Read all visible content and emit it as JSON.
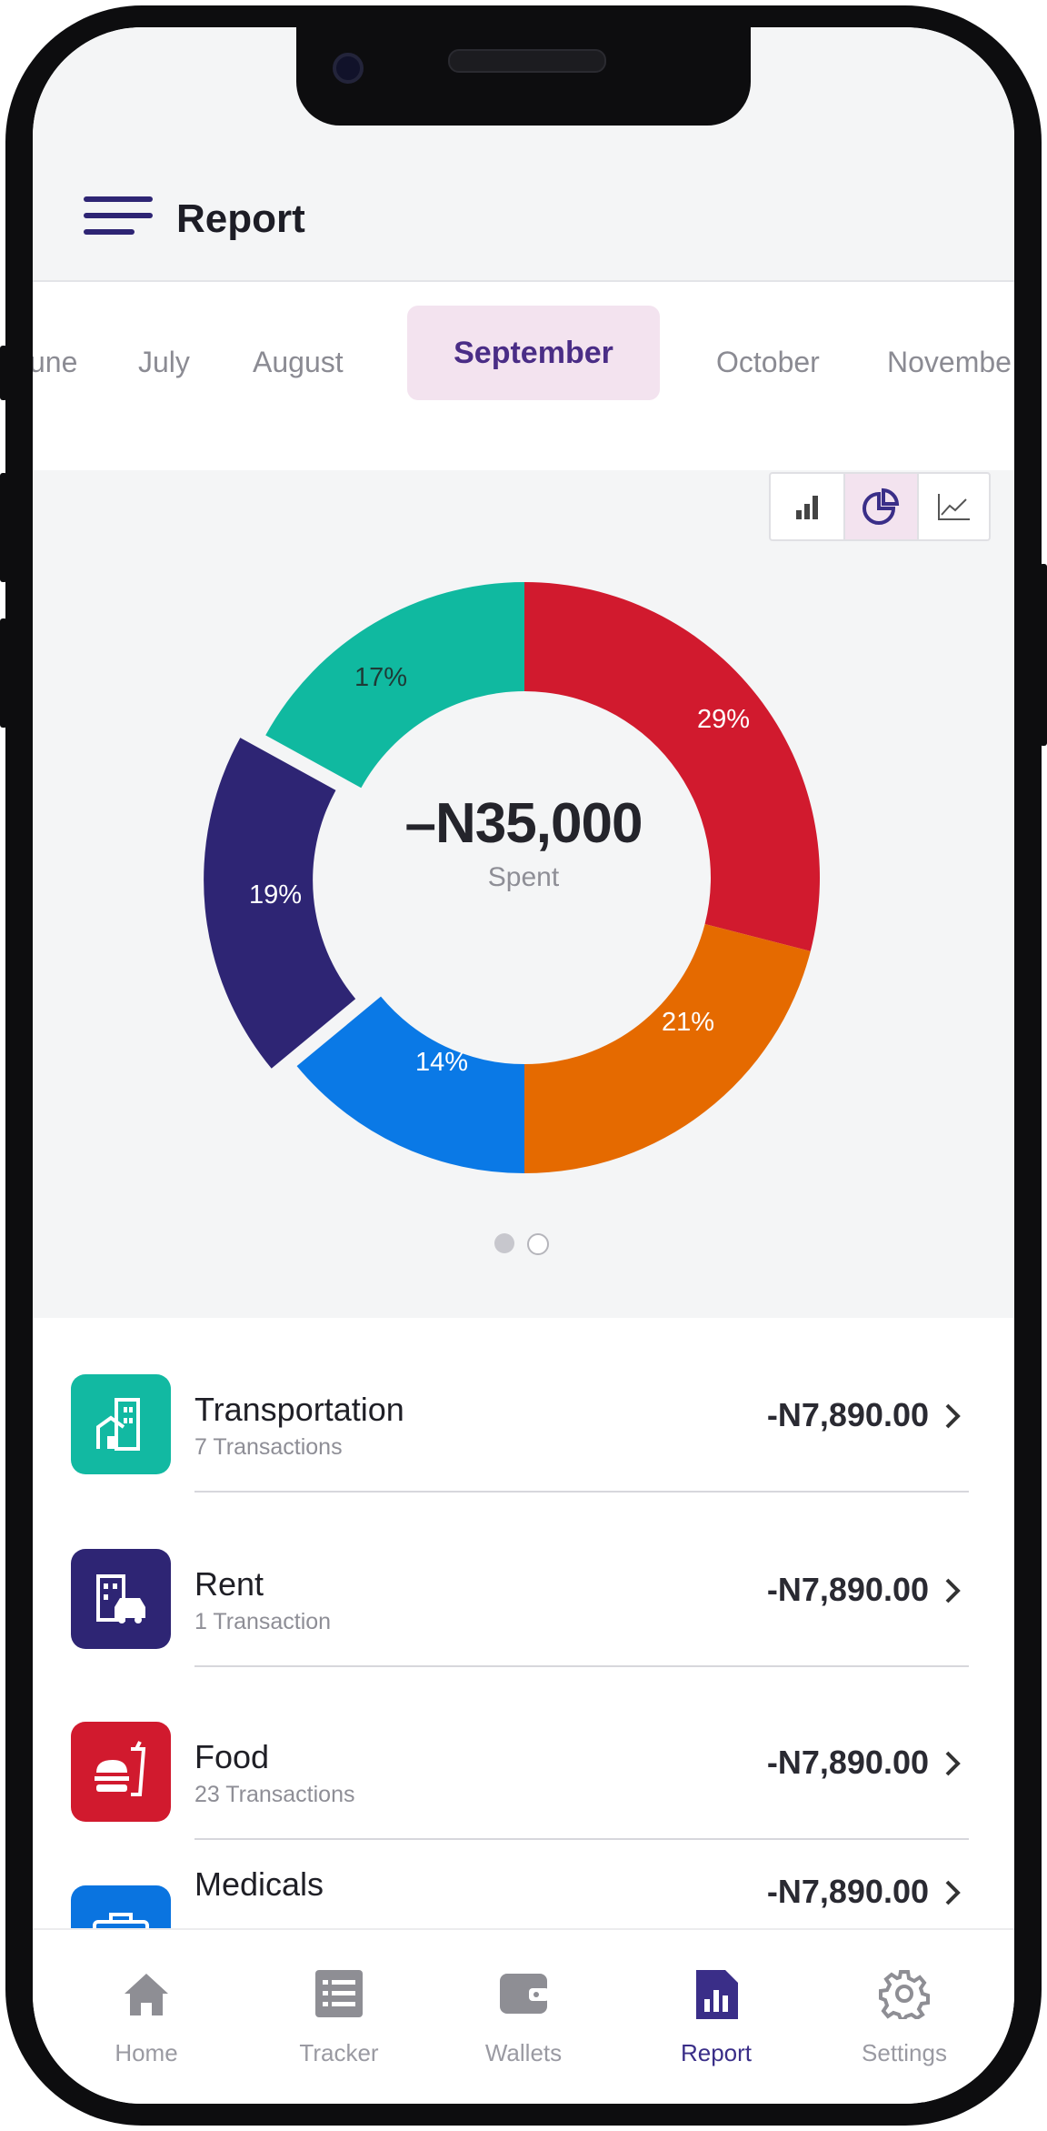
{
  "header": {
    "title": "Report"
  },
  "months": {
    "items": [
      "une",
      "July",
      "August",
      "September",
      "October",
      "Novembe"
    ],
    "active": "September"
  },
  "chart_toggles": [
    "bar-chart-icon",
    "pie-chart-icon",
    "line-chart-icon"
  ],
  "chart_data": {
    "type": "pie",
    "center_value": "–N35,000",
    "center_label": "Spent",
    "slices": [
      {
        "value": 29,
        "label": "29%",
        "color": "#d11a2e"
      },
      {
        "value": 21,
        "label": "21%",
        "color": "#e56a00"
      },
      {
        "value": 14,
        "label": "14%",
        "color": "#0a79e6"
      },
      {
        "value": 19,
        "label": "19%",
        "color": "#2e2574"
      },
      {
        "value": 17,
        "label": "17%",
        "color": "#10b9a0"
      }
    ]
  },
  "pagination": {
    "pages": 2,
    "current": 1
  },
  "categories": [
    {
      "name": "Transportation",
      "count": "7 Transactions",
      "amount": "-N7,890.00",
      "icon": "building-icon",
      "color": "#12b9a2"
    },
    {
      "name": "Rent",
      "count": "1 Transaction",
      "amount": "-N7,890.00",
      "icon": "city-car-icon",
      "color": "#2e2574"
    },
    {
      "name": "Food",
      "count": "23 Transactions",
      "amount": "-N7,890.00",
      "icon": "food-icon",
      "color": "#d11a2e"
    },
    {
      "name": "Medicals",
      "count": "",
      "amount": "-N7,890.00",
      "icon": "medical-kit-icon",
      "color": "#0a74e0"
    }
  ],
  "nav": [
    {
      "label": "Home",
      "icon": "home-icon"
    },
    {
      "label": "Tracker",
      "icon": "list-icon"
    },
    {
      "label": "Wallets",
      "icon": "wallet-icon"
    },
    {
      "label": "Report",
      "icon": "report-icon",
      "active": true
    },
    {
      "label": "Settings",
      "icon": "gear-icon"
    }
  ]
}
